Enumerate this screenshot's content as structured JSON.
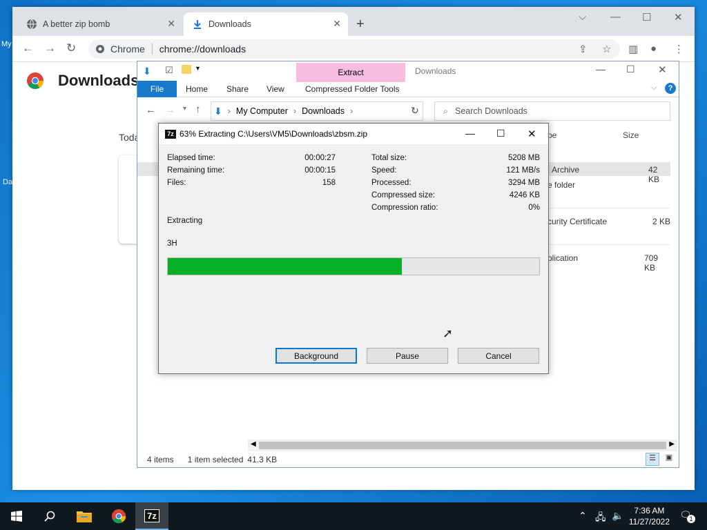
{
  "desktop": {
    "label_1": "My",
    "label_2": "Da"
  },
  "chrome": {
    "tabs": [
      {
        "title": "A better zip bomb",
        "icon": "globe-icon"
      },
      {
        "title": "Downloads",
        "icon": "download-icon"
      }
    ],
    "omnibox": {
      "chip": "Chrome",
      "url": "chrome://downloads"
    },
    "page_title": "Downloads",
    "today_label": "Toda"
  },
  "explorer": {
    "title": "Downloads",
    "context_tab": "Extract",
    "ribbon_tabs": [
      "File",
      "Home",
      "Share",
      "View",
      "Compressed Folder Tools"
    ],
    "breadcrumb": [
      "My Computer",
      "Downloads"
    ],
    "search_placeholder": "Search Downloads",
    "columns": {
      "type": "pe",
      "size": "Size"
    },
    "rows": [
      {
        "type": "Archive",
        "size": "42 KB"
      },
      {
        "type": "e folder",
        "size": ""
      },
      {
        "type": "curity Certificate",
        "size": "2 KB"
      },
      {
        "type": "plication",
        "size": "709 KB"
      }
    ],
    "status": {
      "items": "4 items",
      "selection": "1 item selected",
      "sel_size": "41.3 KB"
    }
  },
  "zip_dialog": {
    "logo": "7z",
    "title": "63% Extracting C:\\Users\\VM5\\Downloads\\zbsm.zip",
    "left_stats": [
      {
        "label": "Elapsed time:",
        "value": "00:00:27"
      },
      {
        "label": "Remaining time:",
        "value": "00:00:15"
      },
      {
        "label": "Files:",
        "value": "158"
      }
    ],
    "right_stats": [
      {
        "label": "Total size:",
        "value": "5208 MB"
      },
      {
        "label": "Speed:",
        "value": "121 MB/s"
      },
      {
        "label": "Processed:",
        "value": "3294 MB"
      },
      {
        "label": "Compressed size:",
        "value": "4246 KB"
      },
      {
        "label": "Compression ratio:",
        "value": "0%"
      }
    ],
    "status": "Extracting",
    "current_file": "3H",
    "progress_percent": 63,
    "buttons": {
      "background": "Background",
      "pause": "Pause",
      "cancel": "Cancel"
    }
  },
  "taskbar": {
    "time": "7:36 AM",
    "date": "11/27/2022",
    "notifications": "1",
    "items": [
      "start-icon",
      "search-icon",
      "file-explorer-icon",
      "chrome-icon",
      "7zip-icon"
    ]
  }
}
